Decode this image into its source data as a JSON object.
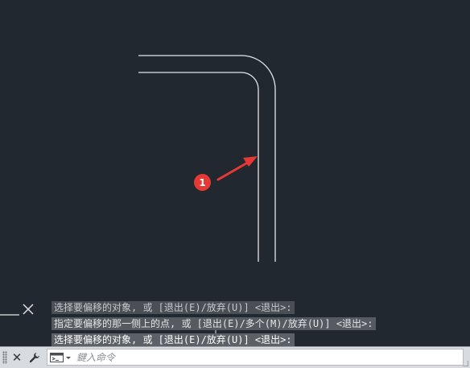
{
  "drawing": {
    "callout_badge": "1",
    "icons": {
      "ucs_marker": "x-cross-icon",
      "arrow": "red-arrow-icon"
    },
    "colors": {
      "background": "#212830",
      "geometry": "#e6e6e6",
      "callout": "#e53935"
    }
  },
  "command_history": [
    "选择要偏移的对象, 或 [退出(E)/放弃(U)] <退出>:",
    "指定要偏移的那一侧上的点, 或 [退出(E)/多个(M)/放弃(U)] <退出>:",
    "选择要偏移的对象, 或 [退出(E)/放弃(U)] <退出>:"
  ],
  "command_bar": {
    "input_placeholder": "鍵入命令",
    "icons": {
      "grip": "drag-grip-icon",
      "close": "close-icon",
      "customize": "wrench-icon",
      "prompt": "command-prompt-icon",
      "dropdown": "chevron-down-icon"
    }
  }
}
